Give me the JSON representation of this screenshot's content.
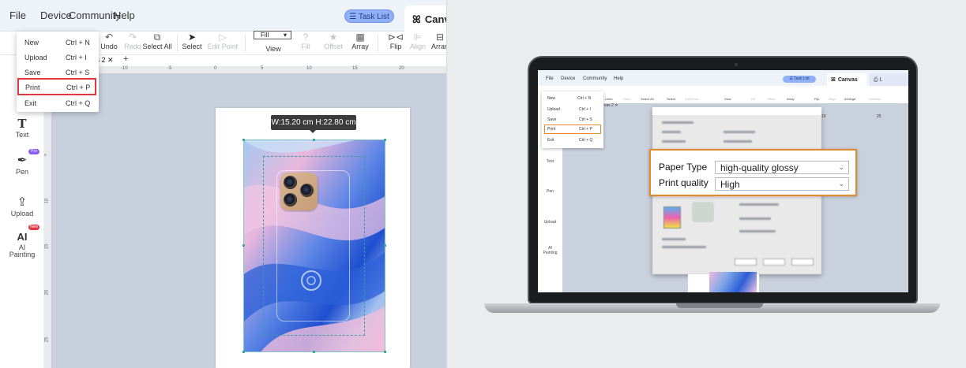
{
  "app": {
    "menu": [
      "File",
      "Device",
      "Community",
      "Help"
    ],
    "task_list": "☰ Task List",
    "canvas_tab": "Canva",
    "canvas_tab_icon": "ꕤ"
  },
  "toolbar": [
    {
      "label": "Undo",
      "icon": "↶",
      "disabled": false
    },
    {
      "label": "Redo",
      "icon": "↷",
      "disabled": true
    },
    {
      "label": "Select All",
      "icon": "⧉",
      "disabled": false
    },
    {
      "label": "Select",
      "icon": "➤",
      "disabled": false
    },
    {
      "label": "Edit Point",
      "icon": "▷",
      "disabled": true
    },
    {
      "label": "View",
      "icon": "",
      "disabled": false
    },
    {
      "label": "Fill",
      "icon": "?",
      "disabled": true
    },
    {
      "label": "Offset",
      "icon": "★",
      "disabled": true
    },
    {
      "label": "Array",
      "icon": "▦",
      "disabled": false
    },
    {
      "label": "Flip",
      "icon": "⊳⊲",
      "disabled": false
    },
    {
      "label": "Align",
      "icon": "⊫",
      "disabled": true
    },
    {
      "label": "Arran",
      "icon": "⊟",
      "disabled": false
    }
  ],
  "fill_select": "Fill",
  "canvas_tab_name": "vas 2 ✕",
  "canvas_tab_add": "+",
  "ruler_h": [
    "-10",
    "-5",
    "0",
    "5",
    "10",
    "15",
    "20"
  ],
  "ruler_v": [
    "5",
    "10",
    "15",
    "20",
    "25"
  ],
  "sidebar": [
    {
      "label": "Text",
      "icon": "T",
      "badge": ""
    },
    {
      "label": "Pen",
      "icon": "✒",
      "badge": "Pro"
    },
    {
      "label": "Upload",
      "icon": "⇪",
      "badge": ""
    },
    {
      "label": "AI\nPainting",
      "icon": "AI",
      "badge": "New"
    }
  ],
  "file_menu": [
    {
      "label": "New",
      "shortcut": "Ctrl + N"
    },
    {
      "label": "Upload",
      "shortcut": "Ctrl + I"
    },
    {
      "label": "Save",
      "shortcut": "Ctrl + S"
    },
    {
      "label": "Print",
      "shortcut": "Ctrl + P",
      "highlighted": true
    },
    {
      "label": "Exit",
      "shortcut": "Ctrl + Q"
    }
  ],
  "dimension_tip": "W:15.20 cm  H:22.80 cm",
  "laptop": {
    "menu": [
      "File",
      "Device",
      "Community",
      "Help"
    ],
    "task_list": "☰ Task List",
    "canvas_tab": "Canvas",
    "second_tab": "L",
    "toolbar": [
      "Undo",
      "Redo",
      "Select All",
      "Select",
      "Edit Point",
      "View",
      "Fill",
      "Offset",
      "Array",
      "Flip",
      "Align",
      "Arrange",
      "Combine"
    ],
    "file_menu": [
      {
        "label": "New",
        "shortcut": "Ctrl + N"
      },
      {
        "label": "Upload",
        "shortcut": "Ctrl + I"
      },
      {
        "label": "Save",
        "shortcut": "Ctrl + S"
      },
      {
        "label": "Print",
        "shortcut": "Ctrl + P"
      },
      {
        "label": "Exit",
        "shortcut": "Ctrl + Q"
      }
    ],
    "sidebar": [
      "Text",
      "Pen",
      "Upload",
      "AI\nPainting"
    ],
    "canvas_tab_name": "vas 2 ✕",
    "ruler": [
      "10",
      "25"
    ],
    "callout": {
      "paper_type_label": "Paper Type",
      "paper_type_value": "high-quality glossy",
      "print_quality_label": "Print quality",
      "print_quality_value": "High"
    }
  },
  "colors": {
    "accent_red": "#e0383e",
    "callout_orange": "#e48a2c",
    "selection_teal": "#3a9e9a"
  }
}
